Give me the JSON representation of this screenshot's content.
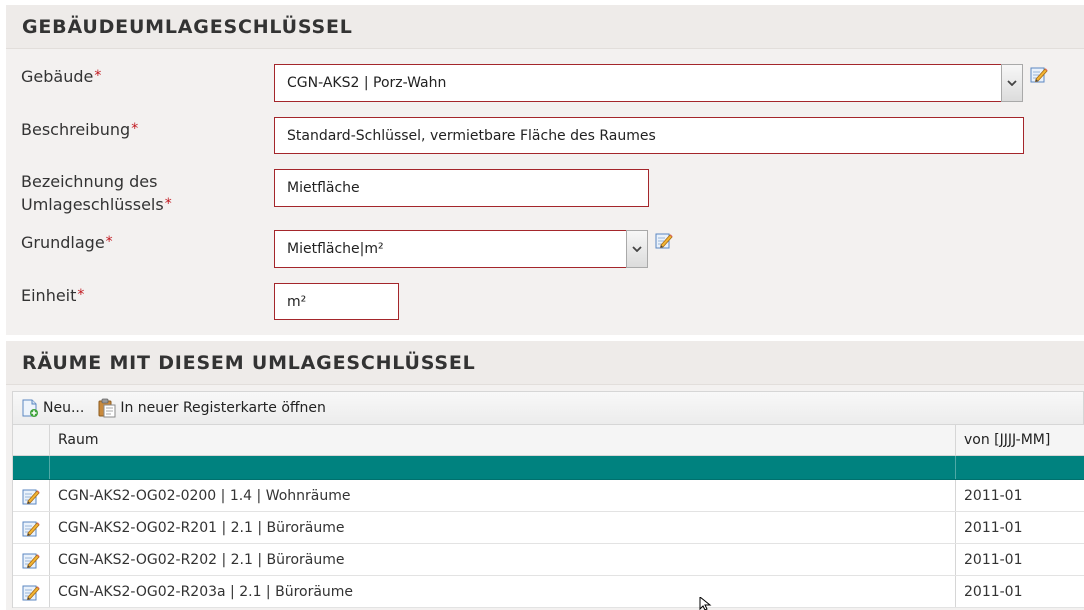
{
  "building_panel": {
    "title": "GEBÄUDEUMLAGESCHLÜSSEL",
    "required_mark": "*",
    "fields": {
      "gebaeude": {
        "label": "Gebäude",
        "value": "CGN-AKS2 | Porz-Wahn"
      },
      "beschreibung": {
        "label": "Beschreibung",
        "value": "Standard-Schlüssel, vermietbare Fläche des Raumes"
      },
      "bezeichnung": {
        "label_line1": "Bezeichnung des",
        "label_line2": "Umlageschlüssels",
        "value": "Mietfläche"
      },
      "grundlage": {
        "label": "Grundlage",
        "value": "Mietfläche|m²"
      },
      "einheit": {
        "label": "Einheit",
        "value": "m²"
      }
    }
  },
  "rooms_panel": {
    "title": "RÄUME MIT DIESEM UMLAGESCHLÜSSEL",
    "toolbar": {
      "new_label": "Neu...",
      "open_tab_label": "In neuer Registerkarte öffnen"
    },
    "columns": {
      "raum": "Raum",
      "von": "von [JJJJ-MM]"
    },
    "rows": [
      {
        "raum": "CGN-AKS2-OG02-0200 | 1.4 | Wohnräume",
        "von": "2011-01"
      },
      {
        "raum": "CGN-AKS2-OG02-R201 | 2.1 | Büroräume",
        "von": "2011-01"
      },
      {
        "raum": "CGN-AKS2-OG02-R202 | 2.1 | Büroräume",
        "von": "2011-01"
      },
      {
        "raum": "CGN-AKS2-OG02-R203a | 2.1 | Büroräume",
        "von": "2011-01"
      }
    ]
  },
  "icons": {
    "edit": "pencil-edit-icon",
    "new": "new-document-icon",
    "open_tab": "clipboard-icon",
    "dropdown": "chevron-down-icon",
    "cursor": "mouse-cursor-icon"
  },
  "colors": {
    "required": "#c0161d",
    "input_border": "#a4262b",
    "selected_row": "#00827f",
    "panel_bg": "#f3f1f0"
  }
}
